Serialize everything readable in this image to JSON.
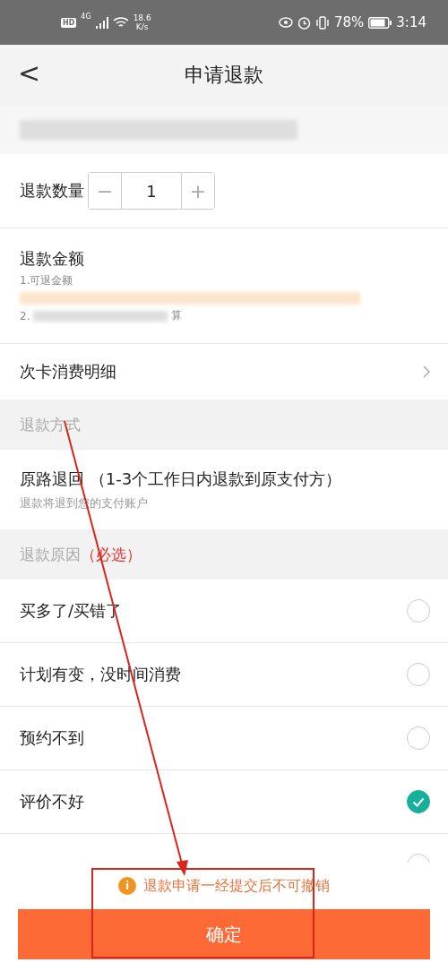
{
  "status_bar": {
    "hd": "HD",
    "network": "4G",
    "speed_value": "18.6",
    "speed_unit": "K/s",
    "battery": "78%",
    "time": "3:14"
  },
  "header": {
    "back": "<",
    "title": "申请退款"
  },
  "quantity": {
    "label": "退款数量",
    "minus": "−",
    "value": "1",
    "plus": "+"
  },
  "amount": {
    "label": "退款金额",
    "note_1": "1.可退金额",
    "note_2_start": "2.",
    "note_2_end": "算"
  },
  "card_detail": {
    "label": "次卡消费明细"
  },
  "refund_method": {
    "heading": "退款方式",
    "title": "原路退回",
    "detail": "（1-3个工作日内退款到原支付方）",
    "sub": "退款将退到您的支付账户"
  },
  "refund_reason": {
    "heading": "退款原因",
    "required": "（必选）",
    "options": [
      {
        "label": "买多了/买错了",
        "selected": false
      },
      {
        "label": "计划有变，没时间消费",
        "selected": false
      },
      {
        "label": "预约不到",
        "selected": false
      },
      {
        "label": "评价不好",
        "selected": true
      },
      {
        "selected": false
      }
    ]
  },
  "footer": {
    "notice_icon": "i",
    "notice": "退款申请一经提交后不可撤销",
    "confirm": "确定"
  }
}
